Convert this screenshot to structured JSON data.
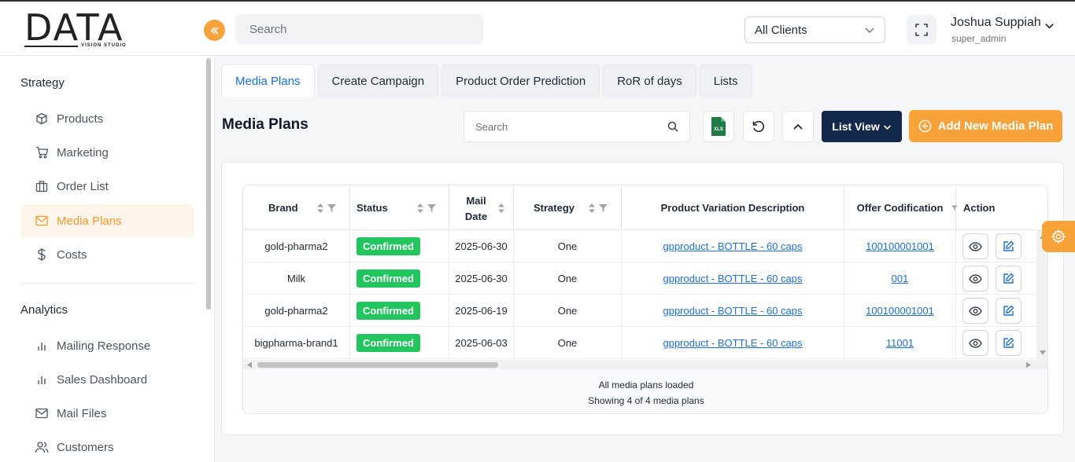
{
  "brand": {
    "logo_text": "DATA",
    "logo_sub": "VISION STUDIO"
  },
  "header": {
    "search_placeholder": "Search",
    "client_select": "All Clients",
    "user_name": "Joshua Suppiah",
    "user_role": "super_admin"
  },
  "sidebar": {
    "section_strategy": "Strategy",
    "strategy_items": [
      {
        "label": "Products",
        "icon": "box-icon"
      },
      {
        "label": "Marketing",
        "icon": "cart-icon"
      },
      {
        "label": "Order List",
        "icon": "briefcase-icon"
      },
      {
        "label": "Media Plans",
        "icon": "mail-icon"
      },
      {
        "label": "Costs",
        "icon": "dollar-icon"
      }
    ],
    "section_analytics": "Analytics",
    "analytics_items": [
      {
        "label": "Mailing Response",
        "icon": "bar-chart-icon"
      },
      {
        "label": "Sales Dashboard",
        "icon": "bar-chart-icon"
      },
      {
        "label": "Mail Files",
        "icon": "mail-icon"
      },
      {
        "label": "Customers",
        "icon": "users-icon"
      }
    ]
  },
  "tabs": [
    "Media Plans",
    "Create Campaign",
    "Product Order Prediction",
    "RoR of days",
    "Lists"
  ],
  "toolbar": {
    "title": "Media Plans",
    "search_placeholder": "Search",
    "excel_label": "XLS",
    "list_view_label": "List View",
    "add_label": "Add New Media Plan"
  },
  "table": {
    "headers": {
      "brand": "Brand",
      "status": "Status",
      "mail_date_1": "Mail",
      "mail_date_2": "Date",
      "strategy": "Strategy",
      "pvd": "Product Variation Description",
      "offer": "Offer Codification",
      "action": "Action"
    },
    "rows": [
      {
        "brand": "gold-pharma2",
        "status": "Confirmed",
        "date": "2025-06-30",
        "strategy": "One",
        "pvd": "gpproduct - BOTTLE - 60 caps",
        "offer": "100100001001"
      },
      {
        "brand": "Milk",
        "status": "Confirmed",
        "date": "2025-06-30",
        "strategy": "One",
        "pvd": "gpproduct - BOTTLE - 60 caps",
        "offer": "001"
      },
      {
        "brand": "gold-pharma2",
        "status": "Confirmed",
        "date": "2025-06-19",
        "strategy": "One",
        "pvd": "gpproduct - BOTTLE - 60 caps",
        "offer": "100100001001"
      },
      {
        "brand": "bigpharma-brand1",
        "status": "Confirmed",
        "date": "2025-06-03",
        "strategy": "One",
        "pvd": "gpproduct - BOTTLE - 60 caps",
        "offer": "11001"
      }
    ],
    "footer_1": "All media plans loaded",
    "footer_2": "Showing 4 of 4 media plans"
  },
  "colors": {
    "accent": "#f8a23a",
    "navy": "#13294b",
    "link": "#1d6fd8",
    "success": "#22c55e"
  }
}
